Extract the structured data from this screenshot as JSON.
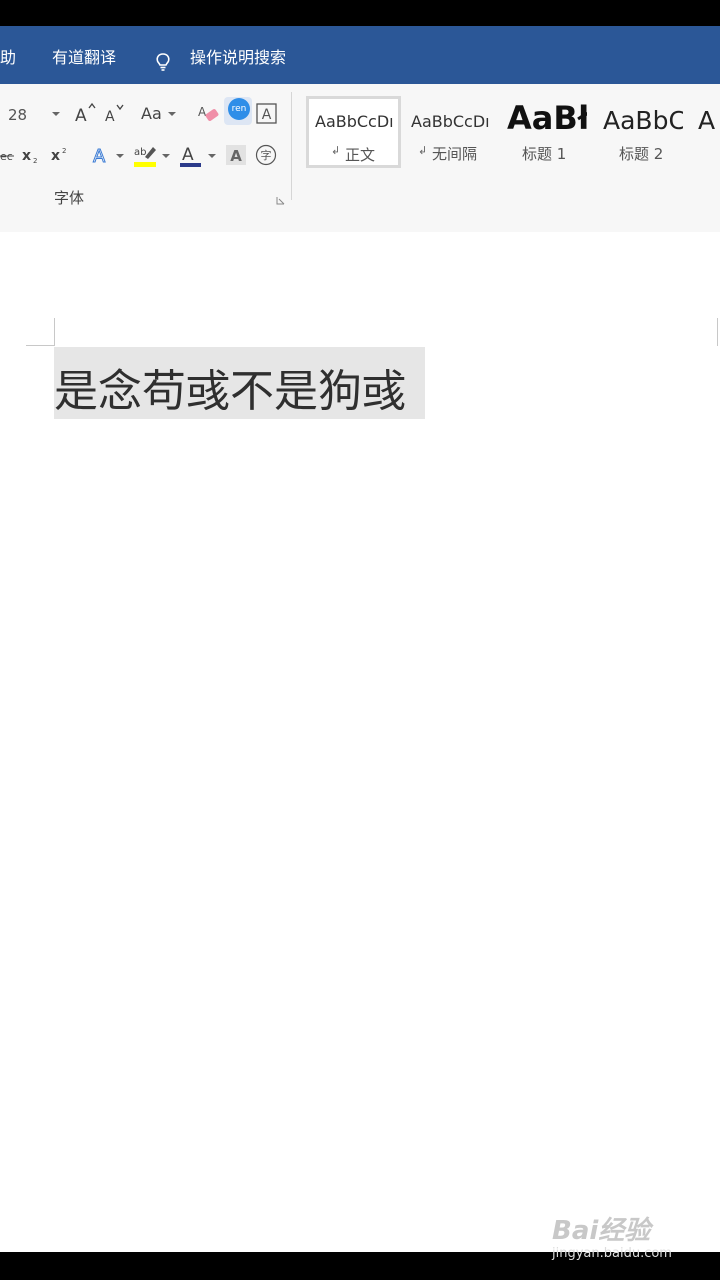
{
  "menu": {
    "items": [
      "助",
      "有道翻译",
      "操作说明搜索"
    ]
  },
  "ribbon": {
    "font_size": "28",
    "font_group_label": "字体",
    "row1_icons": [
      "grow-font-icon",
      "shrink-font-icon",
      "change-case-icon",
      "clear-format-icon",
      "phonetic-guide-icon",
      "char-border-icon"
    ],
    "row2_icons": [
      "strikethrough-icon",
      "subscript-icon",
      "superscript-icon",
      "text-effects-icon",
      "highlight-icon",
      "font-color-icon",
      "char-shading-icon",
      "enclose-char-icon"
    ],
    "change_case_label": "Aa",
    "phonetic_label": "ren"
  },
  "styles": [
    {
      "preview": "AaBbCcDı",
      "label": "正文",
      "selected": true
    },
    {
      "preview": "AaBbCcDı",
      "label": "无间隔",
      "selected": false
    },
    {
      "preview": "AaBł",
      "label": "标题 1",
      "selected": false
    },
    {
      "preview": "AaBbC",
      "label": "标题 2",
      "selected": false
    },
    {
      "preview": "A",
      "label": "",
      "selected": false
    }
  ],
  "document": {
    "text": "是念苟彧不是狗彧"
  },
  "watermark": {
    "brand": "Bai经验",
    "url": "jingyan.baidu.com"
  },
  "colors": {
    "menubar_bg": "#2b5797",
    "selection": "#e6e6e6",
    "highlight_yellow": "#ffff00",
    "font_color_bar": "#2b3a8a"
  }
}
